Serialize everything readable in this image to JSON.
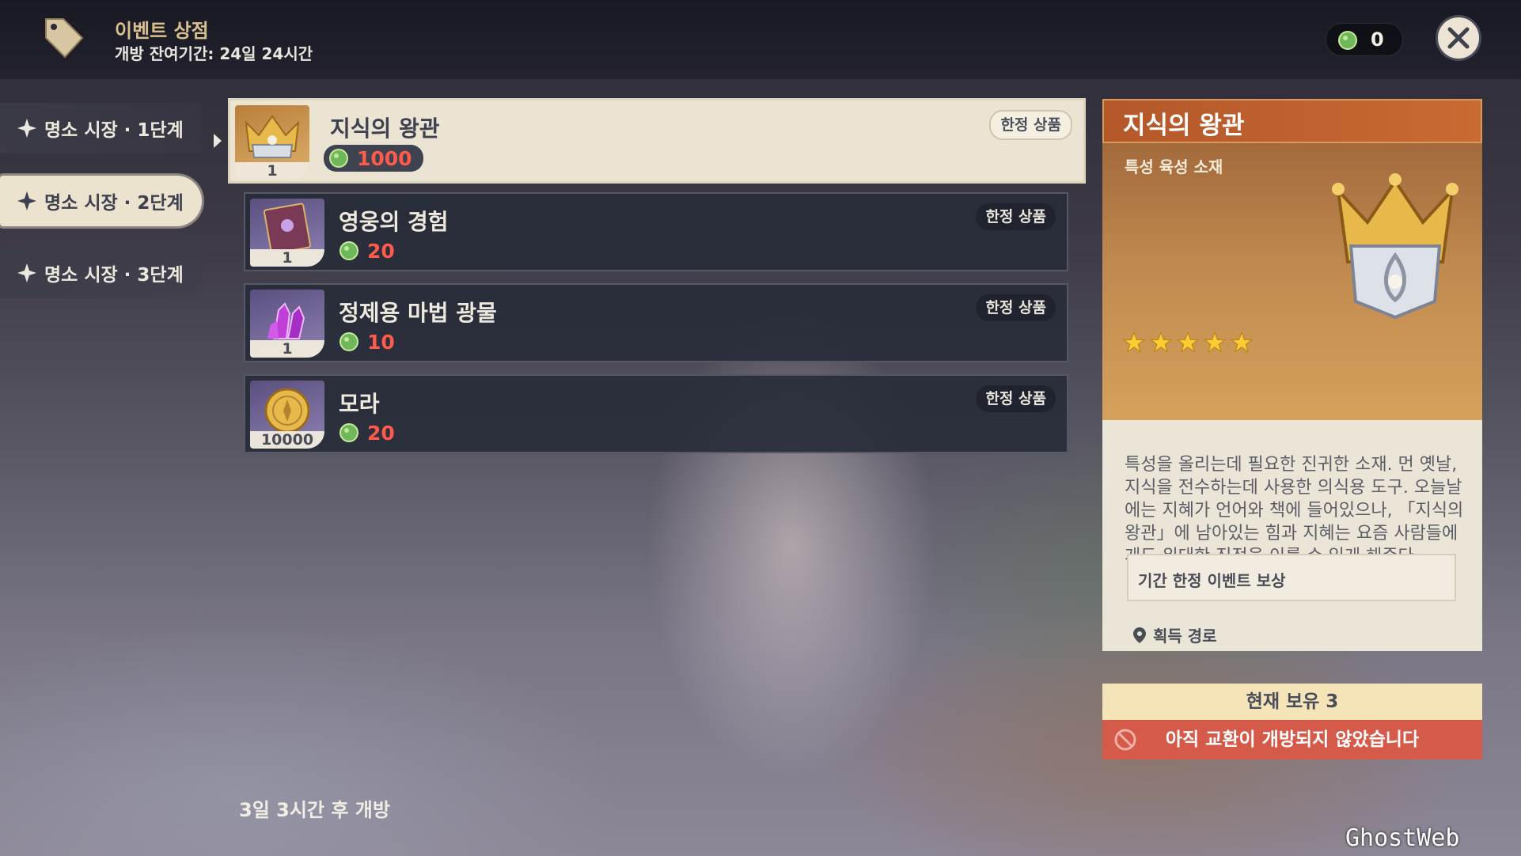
{
  "header": {
    "title": "이벤트 상점",
    "remaining": "개방 잔여기간: 24일 24시간",
    "currency_value": "0"
  },
  "tabs": [
    {
      "label": "명소 시장 · 1단계"
    },
    {
      "label": "명소 시장 · 2단계"
    },
    {
      "label": "명소 시장 · 3단계"
    }
  ],
  "items": [
    {
      "name": "지식의 왕관",
      "price": "1000",
      "count": "1",
      "badge": "한정 상품",
      "icon": "crown-icon"
    },
    {
      "name": "영웅의 경험",
      "price": "20",
      "count": "1",
      "badge": "한정 상품",
      "icon": "book-icon"
    },
    {
      "name": "정제용 마법 광물",
      "price": "10",
      "count": "1",
      "badge": "한정 상품",
      "icon": "crystal-icon"
    },
    {
      "name": "모라",
      "price": "20",
      "count": "10000",
      "badge": "한정 상품",
      "icon": "mora-coin-icon"
    }
  ],
  "detail": {
    "title": "지식의 왕관",
    "type": "특성 육성 소재",
    "rarity_stars": 5,
    "description": "특성을 올리는데 필요한 진귀한 소재. 먼 옛날, 지식을 전수하는데 사용한 의식용 도구. 오늘날에는 지혜가 언어와 책에 들어있으나, 「지식의 왕관」에 남아있는 힘과 지혜는 요즘 사람들에게도 위대한 진전을 이룰 수 있게 해준다",
    "acquisition_label": "획득 경로",
    "acquisition_value": "기간 한정 이벤트 보상"
  },
  "owned_label": "현재 보유 3",
  "exchange_status": "아직 교환이 개방되지 않았습니다",
  "open_in": "3일 3시간 후 개방",
  "watermark": "GhostWeb",
  "colors": {
    "price_red": "#ff5a4a",
    "detail_header": "#c0612e",
    "status_red": "#d65a4a"
  }
}
